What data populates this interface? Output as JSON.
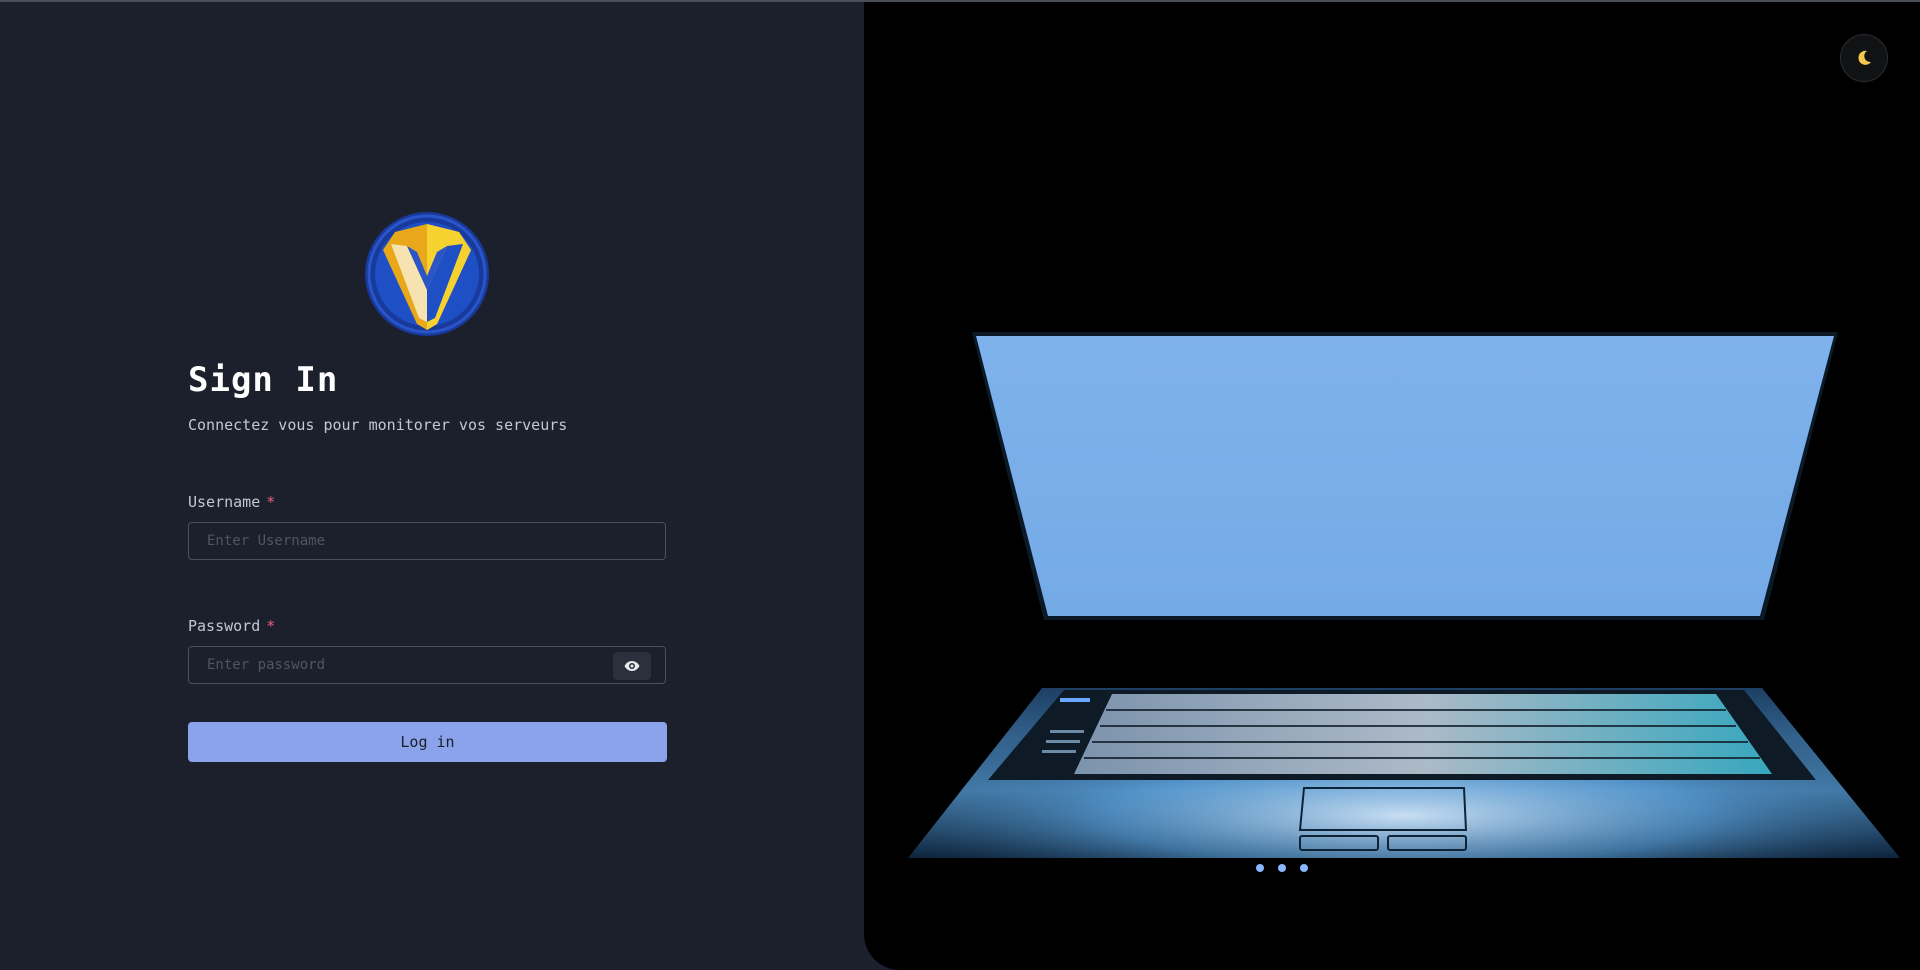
{
  "login": {
    "title": "Sign In",
    "subtitle": "Connectez vous pour monitorer vos serveurs",
    "username_label": "Username",
    "username_required": "*",
    "username_placeholder": "Enter Username",
    "password_label": "Password",
    "password_required": "*",
    "password_placeholder": "Enter password",
    "submit_label": "Log in"
  },
  "icons": {
    "logo": "v-shield-logo",
    "toggle_visibility": "eye-icon",
    "theme_toggle": "moon-icon"
  },
  "colors": {
    "panel_background": "#1b202c",
    "button_primary": "#8aa3ea",
    "required_marker": "#e2637a",
    "logo_gold": "#f2c21b",
    "logo_blue": "#1f4fc4"
  }
}
